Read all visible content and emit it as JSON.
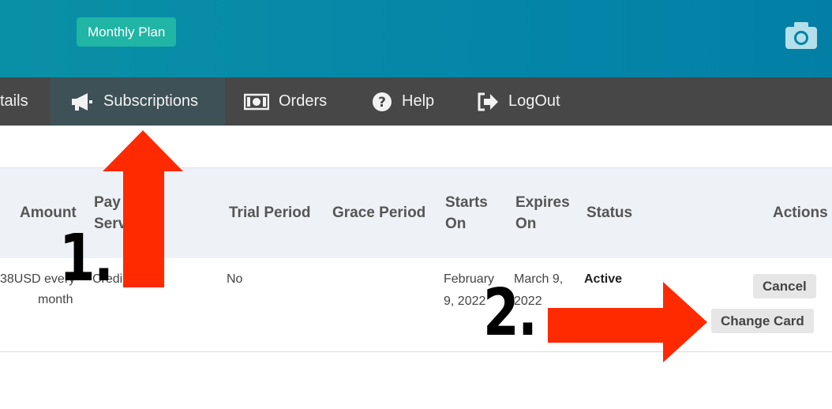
{
  "header": {
    "plan_badge": "Monthly Plan",
    "camera_icon": "camera-icon"
  },
  "nav": {
    "items": [
      {
        "label": "tails",
        "icon": "none"
      },
      {
        "label": "Subscriptions",
        "icon": "megaphone-icon",
        "active": true
      },
      {
        "label": "Orders",
        "icon": "money-icon"
      },
      {
        "label": "Help",
        "icon": "question-circle-icon"
      },
      {
        "label": "LogOut",
        "icon": "logout-icon"
      }
    ]
  },
  "table": {
    "headers": {
      "amount": "Amount",
      "payment_line1": "Pay",
      "payment_line2": "Serv",
      "trial": "Trial Period",
      "grace": "Grace Period",
      "starts_line1": "Starts",
      "starts_line2": "On",
      "expires_line1": "Expires",
      "expires_line2": "On",
      "status": "Status",
      "actions": "Actions"
    },
    "rows": [
      {
        "amount_line1": "38USD every",
        "amount_line2": "month",
        "payment": "Credi",
        "trial": "No",
        "grace": "",
        "starts_line1": "February",
        "starts_line2": "9, 2022",
        "expires_line1": "March 9,",
        "expires_line2": "2022",
        "status": "Active",
        "actions": {
          "cancel": "Cancel",
          "change_card": "Change Card"
        }
      }
    ]
  },
  "annotations": {
    "step1": "1.",
    "step2": "2.",
    "arrow_color": "#ff2a00"
  },
  "colors": {
    "header_bg": "#0486a8",
    "badge_bg": "#20b5a4",
    "nav_bg": "#474747",
    "nav_active_bg": "#3e5157",
    "table_head_bg": "#eef1f6"
  }
}
